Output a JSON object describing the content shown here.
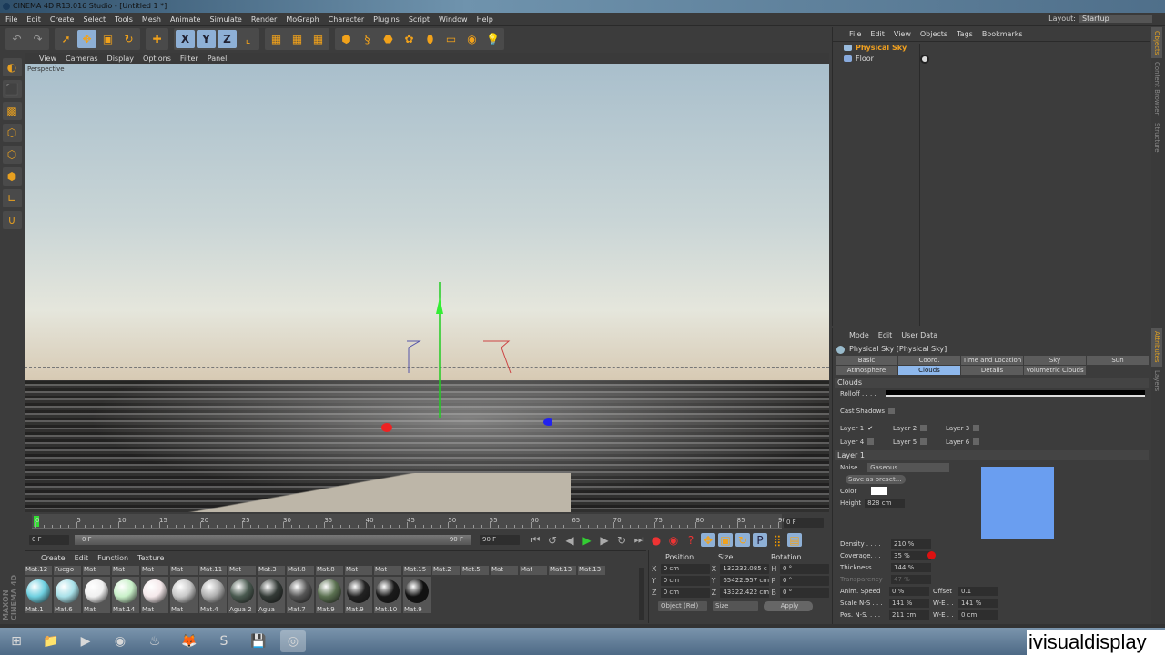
{
  "window": {
    "title": "CINEMA 4D R13.016 Studio - [Untitled 1 *]"
  },
  "menu": [
    "File",
    "Edit",
    "Create",
    "Select",
    "Tools",
    "Mesh",
    "Animate",
    "Simulate",
    "Render",
    "MoGraph",
    "Character",
    "Plugins",
    "Script",
    "Window",
    "Help"
  ],
  "layout": {
    "label": "Layout:",
    "value": "Startup"
  },
  "toolbar": {
    "icons": [
      "undo-icon",
      "redo-icon",
      "live-selection-icon",
      "move-icon",
      "scale-icon",
      "rotate-icon",
      "add-icon",
      "x-axis-icon",
      "y-axis-icon",
      "z-axis-icon",
      "coordinate-system-icon",
      "render-view-icon",
      "render-picture-viewer-icon",
      "render-settings-icon",
      "cube-icon",
      "spline-icon",
      "nurbs-icon",
      "array-icon",
      "deformer-icon",
      "floor-icon",
      "camera-icon",
      "light-icon"
    ],
    "glyphs": [
      "↶",
      "↷",
      "➚",
      "✥",
      "▣",
      "↻",
      "✚",
      "X",
      "Y",
      "Z",
      "⌞",
      "▦",
      "▦",
      "▦",
      "⬢",
      "§",
      "⬣",
      "✿",
      "⬮",
      "▭",
      "◉",
      "💡"
    ]
  },
  "left_tools": [
    {
      "icon": "make-editable-icon",
      "glyph": "◐"
    },
    {
      "icon": "model-mode-icon",
      "glyph": "⬛"
    },
    {
      "icon": "texture-mode-icon",
      "glyph": "▩"
    },
    {
      "icon": "points-mode-icon",
      "glyph": "⬡"
    },
    {
      "icon": "edges-mode-icon",
      "glyph": "⬡"
    },
    {
      "icon": "polygons-mode-icon",
      "glyph": "⬢"
    },
    {
      "icon": "axis-icon",
      "glyph": "∟"
    },
    {
      "icon": "magnet-icon",
      "glyph": "∪"
    }
  ],
  "viewport": {
    "menu": [
      "View",
      "Cameras",
      "Display",
      "Options",
      "Filter",
      "Panel"
    ],
    "label": "Perspective"
  },
  "timeline": {
    "ticks": [
      0,
      5,
      10,
      15,
      20,
      25,
      30,
      35,
      40,
      45,
      50,
      55,
      60,
      65,
      70,
      75,
      80,
      85,
      90
    ],
    "current_frame": "0 F",
    "start": "0 F",
    "range_start": "0 F",
    "range_end": "90 F",
    "end": "90 F"
  },
  "materials": {
    "menu": [
      "Create",
      "Edit",
      "Function",
      "Texture"
    ],
    "headers": [
      "Mat.12",
      "Fuego",
      "Mat",
      "Mat",
      "Mat",
      "Mat",
      "Mat.11",
      "Mat",
      "Mat.3",
      "Mat.8",
      "Mat.8",
      "Mat",
      "Mat",
      "Mat.15",
      "Mat.2",
      "Mat.5",
      "Mat",
      "Mat",
      "Mat.13",
      "Mat.13"
    ],
    "items": [
      {
        "name": "Mat.1",
        "color": "#6fd0e0"
      },
      {
        "name": "Mat.6",
        "color": "#a8e0e8"
      },
      {
        "name": "Mat",
        "color": "#f0f0f0"
      },
      {
        "name": "Mat.14",
        "color": "#c8f0c8"
      },
      {
        "name": "Mat",
        "color": "#f4e8ea"
      },
      {
        "name": "Mat",
        "color": "#c8c8c8"
      },
      {
        "name": "Mat.4",
        "color": "#b0b0b0"
      },
      {
        "name": "Agua 2",
        "color": "#4a5a50"
      },
      {
        "name": "Agua",
        "color": "#333a36"
      },
      {
        "name": "Mat.7",
        "color": "#555"
      },
      {
        "name": "Mat.9",
        "color": "#5a7050"
      },
      {
        "name": "Mat.9",
        "color": "#222"
      },
      {
        "name": "Mat.10",
        "color": "#1a1a1a"
      },
      {
        "name": "Mat.9",
        "color": "#111"
      }
    ]
  },
  "brand": "MAXON CINEMA 4D",
  "coordinates": {
    "headers": [
      "Position",
      "Size",
      "Rotation"
    ],
    "rows": [
      {
        "axis": "X",
        "pos": "0 cm",
        "saxis": "X",
        "size": "132232.085 c",
        "raxis": "H",
        "rot": "0 °"
      },
      {
        "axis": "Y",
        "pos": "0 cm",
        "saxis": "Y",
        "size": "65422.957 cm",
        "raxis": "P",
        "rot": "0 °"
      },
      {
        "axis": "Z",
        "pos": "0 cm",
        "saxis": "Z",
        "size": "43322.422 cm",
        "raxis": "B",
        "rot": "0 °"
      }
    ],
    "mode": "Object (Rel)",
    "size_mode": "Size",
    "apply": "Apply"
  },
  "objects": {
    "menu": [
      "File",
      "Edit",
      "View",
      "Objects",
      "Tags",
      "Bookmarks"
    ],
    "items": [
      {
        "name": "Physical Sky",
        "selected": true,
        "color": "#f0a020"
      },
      {
        "name": "Floor",
        "selected": false,
        "color": "#ddd"
      }
    ]
  },
  "attributes": {
    "menu": [
      "Mode",
      "Edit",
      "User Data"
    ],
    "title": "Physical Sky [Physical Sky]",
    "tabs": [
      "Basic",
      "Coord.",
      "Time and Location",
      "Sky",
      "Sun",
      "Atmosphere",
      "Clouds",
      "Details",
      "Volumetric Clouds"
    ],
    "active_tab": "Clouds",
    "section": "Clouds",
    "rolloff": "Rolloff . . . .",
    "cast_shadows": "Cast Shadows",
    "layers": [
      {
        "label": "Layer 1",
        "checked": true
      },
      {
        "label": "Layer 2",
        "checked": false
      },
      {
        "label": "Layer 3",
        "checked": false
      },
      {
        "label": "Layer 4",
        "checked": false
      },
      {
        "label": "Layer 5",
        "checked": false
      },
      {
        "label": "Layer 6",
        "checked": false
      }
    ],
    "layer_section": "Layer 1",
    "noise_label": "Noise. .",
    "noise": "Gaseous",
    "save_preset": "Save as preset...",
    "color_label": "Color",
    "color": "#ffffff",
    "height_label": "Height",
    "height": "828 cm",
    "preview_color": "#6a9ef0",
    "density_label": "Density . . . .",
    "density": "210 %",
    "coverage_label": "Coverage. . .",
    "coverage": "35 %",
    "thickness_label": "Thickness . .",
    "thickness": "144 %",
    "transparency_label": "Transparency",
    "transparency": "47 %",
    "anim_speed_label": "Anim. Speed",
    "anim_speed": "0 %",
    "offset_label": "Offset",
    "offset": "0.1",
    "scale_ns_label": "Scale N-S . . .",
    "scale_ns": "141 %",
    "scale_we_label": "W-E . .",
    "scale_we": "141 %",
    "pos_ns_label": "Pos. N-S. . . .",
    "pos_ns": "211 cm",
    "pos_we_label": "W-E . .",
    "pos_we": "0 cm"
  },
  "right_tabs": {
    "top": [
      "Objects",
      "Content Browser",
      "Structure"
    ],
    "bottom": [
      "Attributes",
      "Layers"
    ]
  },
  "taskbar": [
    {
      "icon": "start-icon",
      "glyph": "⊞"
    },
    {
      "icon": "explorer-icon",
      "glyph": "📁"
    },
    {
      "icon": "media-player-icon",
      "glyph": "▶"
    },
    {
      "icon": "chrome-icon",
      "glyph": "◉"
    },
    {
      "icon": "steam-icon",
      "glyph": "♨"
    },
    {
      "icon": "firefox-icon",
      "glyph": "🦊"
    },
    {
      "icon": "skype-icon",
      "glyph": "S"
    },
    {
      "icon": "save-icon",
      "glyph": "💾"
    },
    {
      "icon": "cinema4d-icon",
      "glyph": "◎"
    }
  ],
  "watermark": "ivisualdisplay"
}
